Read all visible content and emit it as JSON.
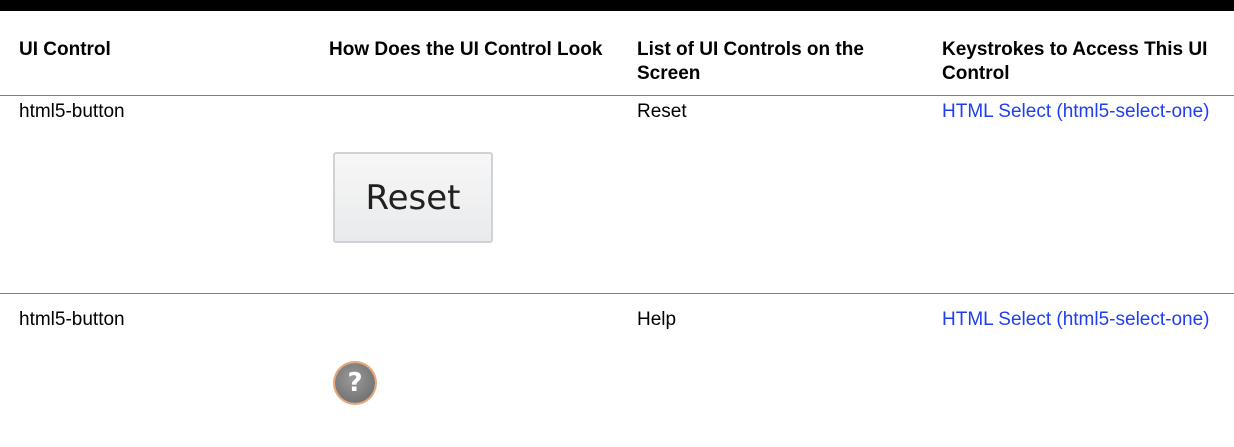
{
  "table": {
    "headers": {
      "col1": "UI Control",
      "col2": "How Does the UI Control Look",
      "col3": "List of UI Controls on the Screen",
      "col4": "Keystrokes to Access This UI Control"
    },
    "rows": [
      {
        "ui_control": "html5-button",
        "look": {
          "button_label": "Reset",
          "icon": "reset-button-image"
        },
        "list": "Reset",
        "keystrokes_link": "HTML Select (html5-select-one)"
      },
      {
        "ui_control": "html5-button",
        "look": {
          "glyph": "?",
          "icon": "help-icon"
        },
        "list": "Help",
        "keystrokes_link": "HTML Select (html5-select-one)"
      }
    ]
  },
  "colors": {
    "link": "#1f3ef1",
    "rule": "#7f7f7f",
    "top_bar": "#000000"
  }
}
